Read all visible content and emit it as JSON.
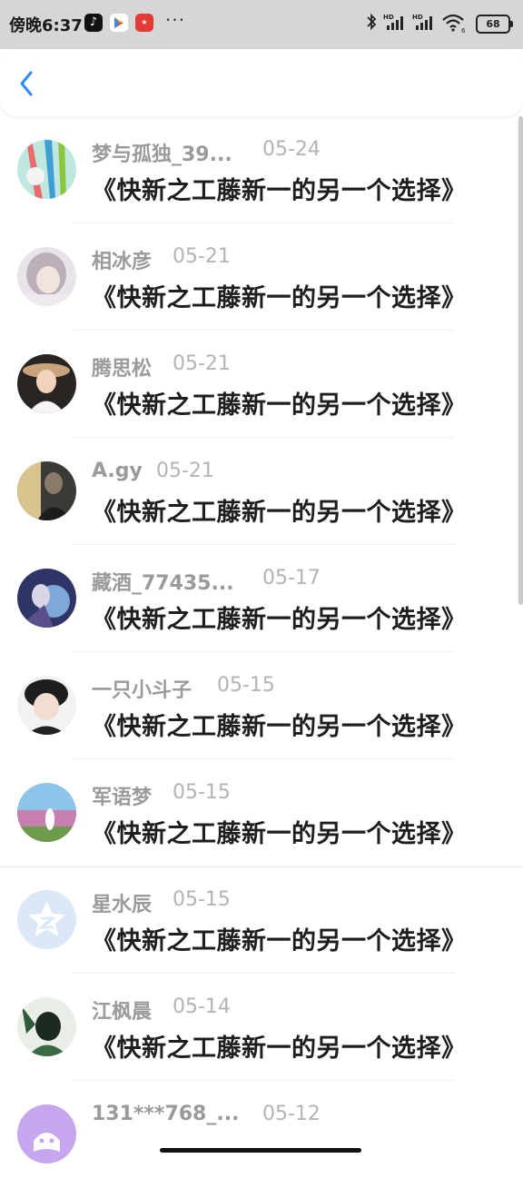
{
  "status_bar": {
    "time": "傍晚6:37",
    "app_icons": [
      "tiktok-icon",
      "play-store-icon",
      "shopping-app-icon"
    ],
    "overflow": "···",
    "battery": "68",
    "network_labels": [
      "HD",
      "HD"
    ]
  },
  "header": {
    "back_icon": "chevron-left-icon",
    "accent_color": "#2d8cf0"
  },
  "list": {
    "items": [
      {
        "name": "梦与孤独_39...",
        "date": "05-24",
        "message": "《快新之工藤新一的另一个选择》",
        "avatar": "avatar-watercolor"
      },
      {
        "name": "相冰彦",
        "date": "05-21",
        "message": "《快新之工藤新一的另一个选择》",
        "avatar": "avatar-girl-soft"
      },
      {
        "name": "腾思松",
        "date": "05-21",
        "message": "《快新之工藤新一的另一个选择》",
        "avatar": "avatar-girl-hat"
      },
      {
        "name": "A.gy",
        "date": "05-21",
        "message": "《快新之工藤新一的另一个选择》",
        "avatar": "avatar-dark-photo"
      },
      {
        "name": "藏酒_77435...",
        "date": "05-17",
        "message": "《快新之工藤新一的另一个选择》",
        "avatar": "avatar-anime-blue"
      },
      {
        "name": "一只小斗子",
        "date": "05-15",
        "message": "《快新之工藤新一的另一个选择》",
        "avatar": "avatar-boy"
      },
      {
        "name": "军语梦",
        "date": "05-15",
        "message": "《快新之工藤新一的另一个选择》",
        "avatar": "avatar-field"
      },
      {
        "name": "星水辰",
        "date": "05-15",
        "message": "《快新之工藤新一的另一个选择》",
        "avatar": "avatar-default-star"
      },
      {
        "name": "江枫晨",
        "date": "05-14",
        "message": "《快新之工藤新一的另一个选择》",
        "avatar": "avatar-anime-green"
      },
      {
        "name": "131***768_...",
        "date": "05-12",
        "message": "",
        "avatar": "avatar-purple"
      }
    ]
  }
}
